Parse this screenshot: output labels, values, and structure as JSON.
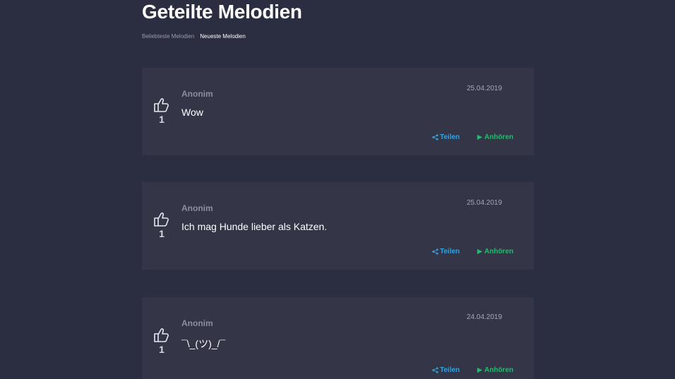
{
  "page": {
    "title": "Geteilte Melodien"
  },
  "tabs": [
    {
      "label": "Beliebteste Melodien",
      "active": false
    },
    {
      "label": "Neueste Melodien",
      "active": true
    }
  ],
  "posts": [
    {
      "author": "Anonim",
      "text": "Wow",
      "date": "25.04.2019",
      "votes": "1",
      "share_label": "Teilen",
      "play_label": "Anhören"
    },
    {
      "author": "Anonim",
      "text": "Ich mag Hunde lieber als Katzen.",
      "date": "25.04.2019",
      "votes": "1",
      "share_label": "Teilen",
      "play_label": "Anhören"
    },
    {
      "author": "Anonim",
      "text": "¯\\_(ツ)_/¯",
      "date": "24.04.2019",
      "votes": "1",
      "share_label": "Teilen",
      "play_label": "Anhören"
    }
  ],
  "icons": {
    "vote": "thumbs-up-icon",
    "share": "share-icon",
    "play": "play-icon"
  },
  "colors": {
    "background": "#2b2d40",
    "card": "#343648",
    "share": "#2ea3e3",
    "play": "#2bb673"
  }
}
